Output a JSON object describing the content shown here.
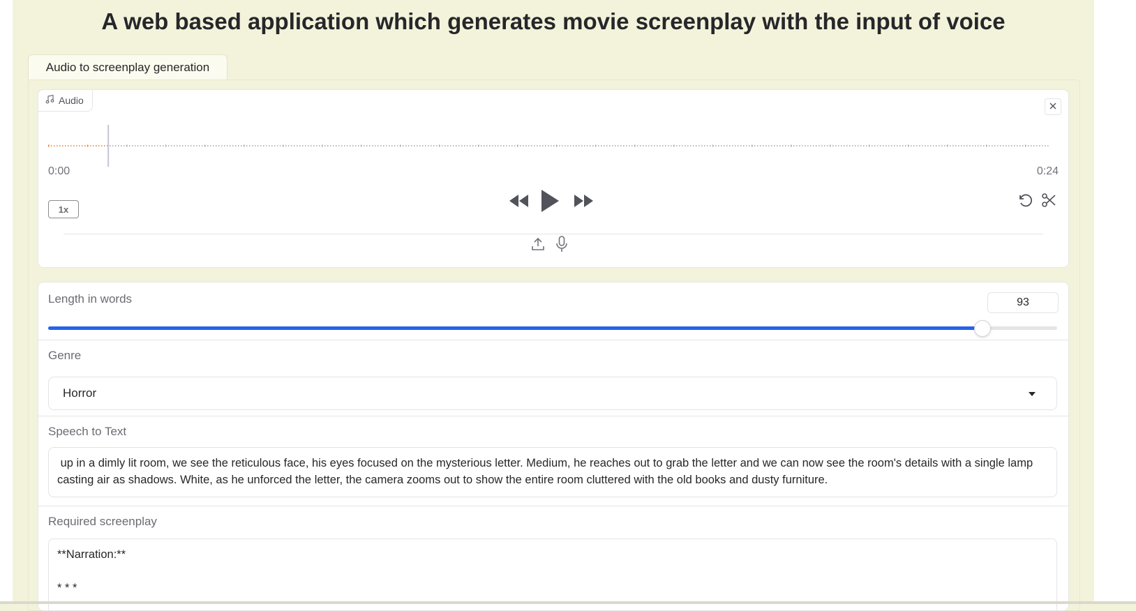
{
  "title": "A web based application which generates movie screenplay with the input of voice",
  "tabs": [
    {
      "label": "Audio to screenplay generation",
      "active": true
    }
  ],
  "audio": {
    "label": "Audio",
    "current_time": "0:00",
    "duration": "0:24",
    "playback_rate": "1x",
    "progress": 0.06
  },
  "length": {
    "label": "Length in words",
    "value": "93",
    "fraction": 0.925
  },
  "genre": {
    "label": "Genre",
    "value": "Horror"
  },
  "speech_to_text": {
    "label": "Speech to Text",
    "value": " up in a dimly lit room, we see the reticulous face, his eyes focused on the mysterious letter. Medium, he reaches out to grab the letter and we can now see the room's details with a single lamp casting air as shadows. White, as he unforced the letter, the camera zooms out to show the entire room cluttered with the old books and dusty furniture."
  },
  "screenplay": {
    "label": "Required screenplay",
    "value": "**Narration:**\n\n* * *"
  },
  "colors": {
    "accent": "#2563eb",
    "background": "#f3f3dc",
    "waveform_played": "#f97316",
    "waveform_unplayed": "#9ca3af"
  }
}
